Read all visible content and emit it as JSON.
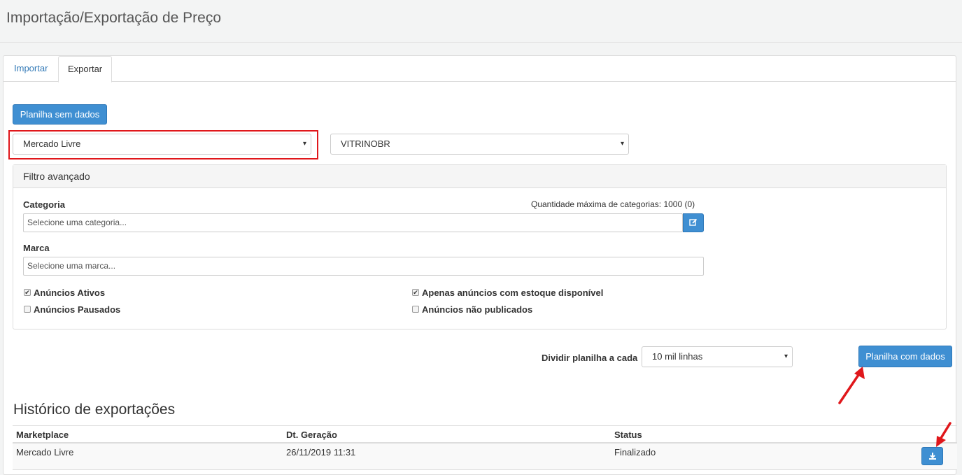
{
  "header": {
    "title": "Importação/Exportação de Preço"
  },
  "tabs": [
    {
      "label": "Importar",
      "active": false
    },
    {
      "label": "Exportar",
      "active": true
    }
  ],
  "actions": {
    "empty_sheet_label": "Planilha sem dados",
    "data_sheet_label": "Planilha com dados"
  },
  "selects": {
    "marketplace": "Mercado Livre",
    "account": "VITRINOBR"
  },
  "filter": {
    "title": "Filtro avançado",
    "category_label": "Categoria",
    "max_categories": "Quantidade máxima de categorias: 1000 (0)",
    "category_placeholder": "Selecione uma categoria...",
    "brand_label": "Marca",
    "brand_placeholder": "Selecione uma marca...",
    "checkboxes": [
      {
        "label": "Anúncios Ativos",
        "checked": true
      },
      {
        "label": "Anúncios Pausados",
        "checked": false
      },
      {
        "label": "Apenas anúncios com estoque disponível",
        "checked": true
      },
      {
        "label": "Anúncios não publicados",
        "checked": false
      }
    ]
  },
  "split": {
    "label": "Dividir planilha a cada",
    "value": "10 mil linhas"
  },
  "history": {
    "title": "Histórico de exportações",
    "columns": [
      "Marketplace",
      "Dt. Geração",
      "Status"
    ],
    "rows": [
      {
        "marketplace": "Mercado Livre",
        "date": "26/11/2019 11:31",
        "status": "Finalizado"
      }
    ]
  },
  "colors": {
    "primary": "#3f8fd2",
    "highlight": "#e0171b",
    "link": "#337ab7"
  },
  "icons": {
    "caret": "▾",
    "check": "✔",
    "edit": "edit-icon",
    "download": "download-icon",
    "annotation": "red-arrow-icon"
  }
}
